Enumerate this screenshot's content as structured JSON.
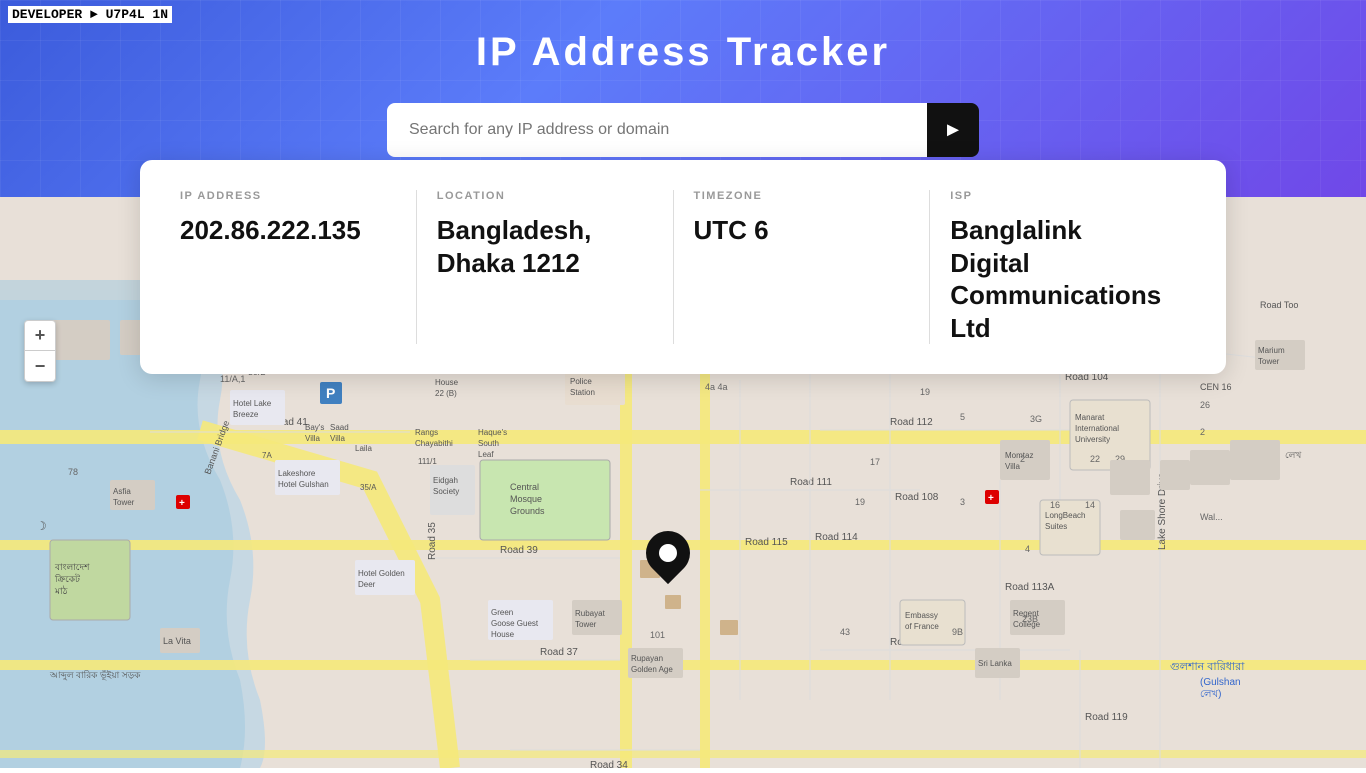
{
  "dev_tag": "DEVELOPER ► U7P4L 1N",
  "header": {
    "title": "IP  Address  Tracker",
    "search_placeholder": "Search for any IP address or domain",
    "search_button_label": "►"
  },
  "info_card": {
    "ip_address": {
      "label": "IP ADDRESS",
      "value": "202.86.222.135"
    },
    "location": {
      "label": "LOCATION",
      "value": "Bangladesh, Dhaka 1212"
    },
    "timezone": {
      "label": "TIMEZONE",
      "value": "UTC 6"
    },
    "isp": {
      "label": "ISP",
      "value": "Banglalink Digital Communications Ltd"
    }
  },
  "zoom": {
    "plus": "+",
    "minus": "−"
  }
}
